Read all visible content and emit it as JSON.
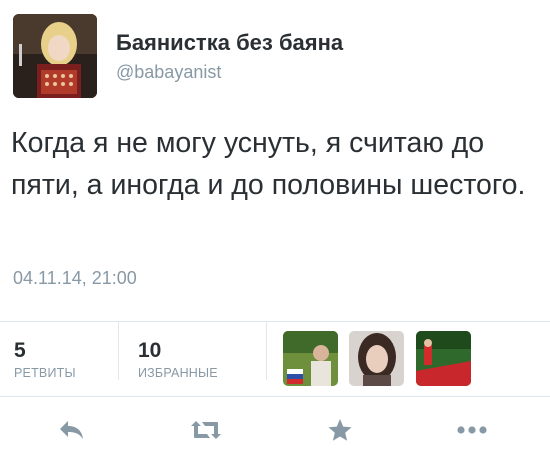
{
  "user": {
    "display_name": "Баянистка без баяна",
    "handle": "@babayanist"
  },
  "tweet": {
    "text": "Когда я не могу уснуть, я считаю до пяти, а иногда и до половины шестого.",
    "timestamp": "04.11.14, 21:00"
  },
  "stats": {
    "retweets_count": "5",
    "retweets_label": "РЕТВИТЫ",
    "favorites_count": "10",
    "favorites_label": "ИЗБРАННЫЕ"
  },
  "actions": {
    "reply_icon": "reply-icon",
    "retweet_icon": "retweet-icon",
    "favorite_icon": "star-icon",
    "more_icon": "more-icon"
  },
  "colors": {
    "text": "#292f33",
    "muted": "#8899a6",
    "icon": "#8899a6",
    "divider": "#e1e8ed"
  }
}
